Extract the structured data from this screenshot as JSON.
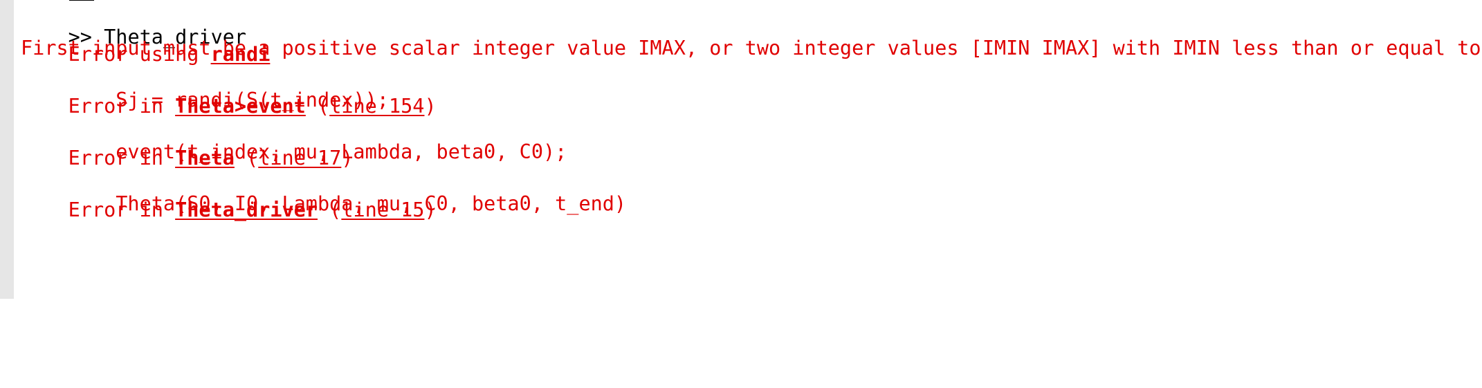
{
  "prompt": {
    "symbol": ">>",
    "command": "Theta_driver"
  },
  "error_header": {
    "prefix": "Error using",
    "function": "randi"
  },
  "error_message": "First input must be a positive scalar integer value IMAX, or two integer values [IMIN IMAX] with IMIN less than or equal to IMAX.",
  "stack": [
    {
      "prefix": "Error in",
      "function": "Theta>event",
      "open": "(",
      "line_label": "line 154",
      "close": ")",
      "code": "        Sj = randi(S(t_index));"
    },
    {
      "prefix": "Error in",
      "function": "Theta",
      "open": "(",
      "line_label": "line 17",
      "close": ")",
      "code": "        event(t_index, mu, Lambda, beta0, C0);"
    },
    {
      "prefix": "Error in",
      "function": "Theta_driver",
      "open": "(",
      "line_label": "line 15",
      "close": ")",
      "code": "        Theta(S0, I0, Lambda, mu, C0, beta0, t_end)"
    }
  ],
  "colors": {
    "error": "#e00000",
    "text": "#000000",
    "gutter": "#e6e6e6"
  }
}
